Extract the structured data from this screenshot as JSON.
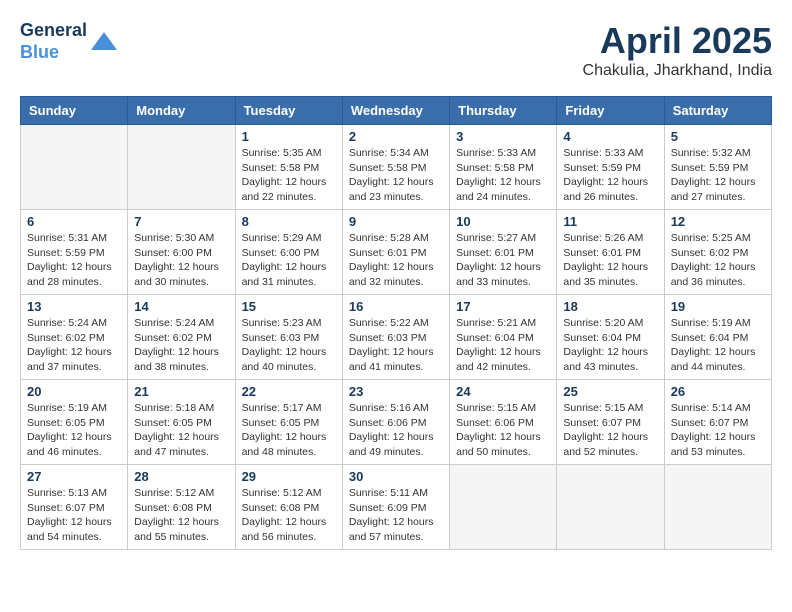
{
  "header": {
    "logo_line1": "General",
    "logo_line2": "Blue",
    "month_title": "April 2025",
    "subtitle": "Chakulia, Jharkhand, India"
  },
  "weekdays": [
    "Sunday",
    "Monday",
    "Tuesday",
    "Wednesday",
    "Thursday",
    "Friday",
    "Saturday"
  ],
  "weeks": [
    [
      {
        "day": "",
        "info": ""
      },
      {
        "day": "",
        "info": ""
      },
      {
        "day": "1",
        "info": "Sunrise: 5:35 AM\nSunset: 5:58 PM\nDaylight: 12 hours and 22 minutes."
      },
      {
        "day": "2",
        "info": "Sunrise: 5:34 AM\nSunset: 5:58 PM\nDaylight: 12 hours and 23 minutes."
      },
      {
        "day": "3",
        "info": "Sunrise: 5:33 AM\nSunset: 5:58 PM\nDaylight: 12 hours and 24 minutes."
      },
      {
        "day": "4",
        "info": "Sunrise: 5:33 AM\nSunset: 5:59 PM\nDaylight: 12 hours and 26 minutes."
      },
      {
        "day": "5",
        "info": "Sunrise: 5:32 AM\nSunset: 5:59 PM\nDaylight: 12 hours and 27 minutes."
      }
    ],
    [
      {
        "day": "6",
        "info": "Sunrise: 5:31 AM\nSunset: 5:59 PM\nDaylight: 12 hours and 28 minutes."
      },
      {
        "day": "7",
        "info": "Sunrise: 5:30 AM\nSunset: 6:00 PM\nDaylight: 12 hours and 30 minutes."
      },
      {
        "day": "8",
        "info": "Sunrise: 5:29 AM\nSunset: 6:00 PM\nDaylight: 12 hours and 31 minutes."
      },
      {
        "day": "9",
        "info": "Sunrise: 5:28 AM\nSunset: 6:01 PM\nDaylight: 12 hours and 32 minutes."
      },
      {
        "day": "10",
        "info": "Sunrise: 5:27 AM\nSunset: 6:01 PM\nDaylight: 12 hours and 33 minutes."
      },
      {
        "day": "11",
        "info": "Sunrise: 5:26 AM\nSunset: 6:01 PM\nDaylight: 12 hours and 35 minutes."
      },
      {
        "day": "12",
        "info": "Sunrise: 5:25 AM\nSunset: 6:02 PM\nDaylight: 12 hours and 36 minutes."
      }
    ],
    [
      {
        "day": "13",
        "info": "Sunrise: 5:24 AM\nSunset: 6:02 PM\nDaylight: 12 hours and 37 minutes."
      },
      {
        "day": "14",
        "info": "Sunrise: 5:24 AM\nSunset: 6:02 PM\nDaylight: 12 hours and 38 minutes."
      },
      {
        "day": "15",
        "info": "Sunrise: 5:23 AM\nSunset: 6:03 PM\nDaylight: 12 hours and 40 minutes."
      },
      {
        "day": "16",
        "info": "Sunrise: 5:22 AM\nSunset: 6:03 PM\nDaylight: 12 hours and 41 minutes."
      },
      {
        "day": "17",
        "info": "Sunrise: 5:21 AM\nSunset: 6:04 PM\nDaylight: 12 hours and 42 minutes."
      },
      {
        "day": "18",
        "info": "Sunrise: 5:20 AM\nSunset: 6:04 PM\nDaylight: 12 hours and 43 minutes."
      },
      {
        "day": "19",
        "info": "Sunrise: 5:19 AM\nSunset: 6:04 PM\nDaylight: 12 hours and 44 minutes."
      }
    ],
    [
      {
        "day": "20",
        "info": "Sunrise: 5:19 AM\nSunset: 6:05 PM\nDaylight: 12 hours and 46 minutes."
      },
      {
        "day": "21",
        "info": "Sunrise: 5:18 AM\nSunset: 6:05 PM\nDaylight: 12 hours and 47 minutes."
      },
      {
        "day": "22",
        "info": "Sunrise: 5:17 AM\nSunset: 6:05 PM\nDaylight: 12 hours and 48 minutes."
      },
      {
        "day": "23",
        "info": "Sunrise: 5:16 AM\nSunset: 6:06 PM\nDaylight: 12 hours and 49 minutes."
      },
      {
        "day": "24",
        "info": "Sunrise: 5:15 AM\nSunset: 6:06 PM\nDaylight: 12 hours and 50 minutes."
      },
      {
        "day": "25",
        "info": "Sunrise: 5:15 AM\nSunset: 6:07 PM\nDaylight: 12 hours and 52 minutes."
      },
      {
        "day": "26",
        "info": "Sunrise: 5:14 AM\nSunset: 6:07 PM\nDaylight: 12 hours and 53 minutes."
      }
    ],
    [
      {
        "day": "27",
        "info": "Sunrise: 5:13 AM\nSunset: 6:07 PM\nDaylight: 12 hours and 54 minutes."
      },
      {
        "day": "28",
        "info": "Sunrise: 5:12 AM\nSunset: 6:08 PM\nDaylight: 12 hours and 55 minutes."
      },
      {
        "day": "29",
        "info": "Sunrise: 5:12 AM\nSunset: 6:08 PM\nDaylight: 12 hours and 56 minutes."
      },
      {
        "day": "30",
        "info": "Sunrise: 5:11 AM\nSunset: 6:09 PM\nDaylight: 12 hours and 57 minutes."
      },
      {
        "day": "",
        "info": ""
      },
      {
        "day": "",
        "info": ""
      },
      {
        "day": "",
        "info": ""
      }
    ]
  ]
}
